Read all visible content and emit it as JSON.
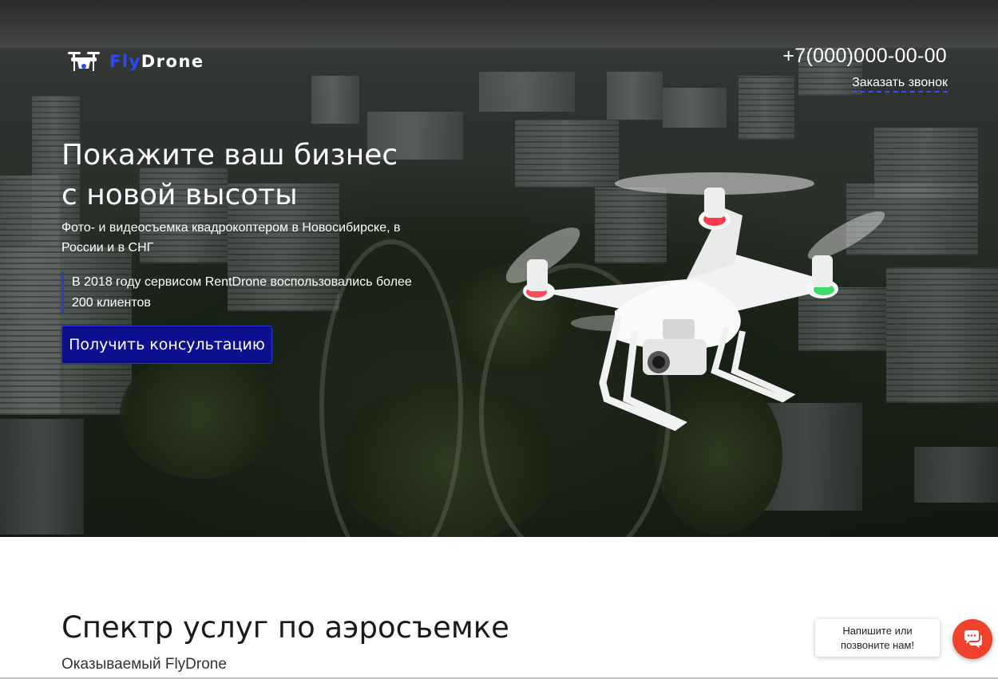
{
  "header": {
    "logo_fly": "Fly",
    "logo_drone": "Drone",
    "phone": "+7(000)000-00-00",
    "callback_label": "Заказать звонок"
  },
  "hero": {
    "headline_line1": "Покажите ваш бизнес",
    "headline_line2": "с новой высоты",
    "subhead": "Фото- и видеосъемка квадрокоптером в Новосибирске, в России и в СНГ",
    "quote": "В 2018 году сервисом RentDrone воспользовались более 200 клиентов",
    "cta_label": "Получить консультацию"
  },
  "services": {
    "title": "Спектр услуг по аэросъемке",
    "subtitle": "Оказываемый FlyDrone"
  },
  "chat": {
    "bubble_line1": "Напишите или",
    "bubble_line2": "позвоните нам!",
    "button_icon": "chat-icon"
  },
  "colors": {
    "brand_blue": "#2b47ff",
    "cta_bg": "#0d0f8f",
    "chat_red": "#f0412c"
  }
}
